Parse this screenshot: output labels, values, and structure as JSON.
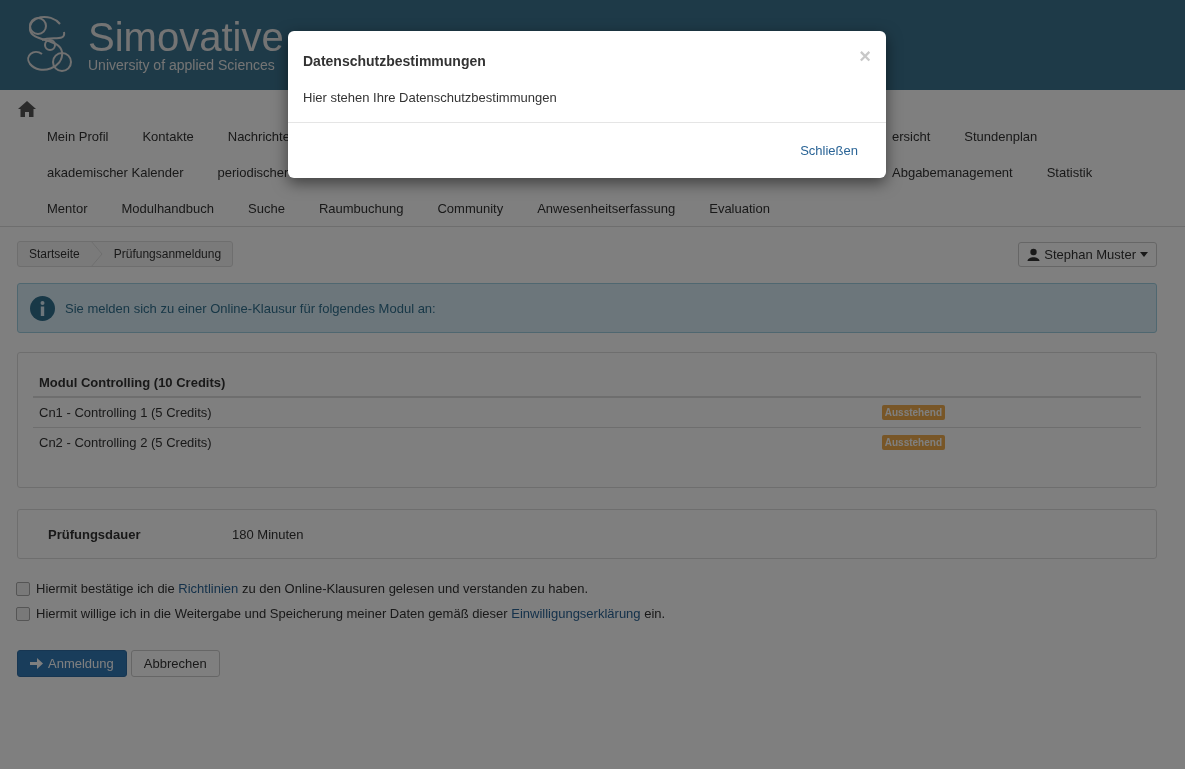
{
  "header": {
    "title": "Simovative",
    "subtitle": "University of applied Sciences"
  },
  "nav": {
    "rows": [
      {
        "left": [
          {
            "label": "Mein Profil"
          },
          {
            "label": "Kontakte"
          },
          {
            "label": "Nachrichte"
          }
        ],
        "right": [
          {
            "label": "ersicht"
          },
          {
            "label": "Stundenplan"
          }
        ]
      },
      {
        "left": [
          {
            "label": "akademischer Kalender"
          },
          {
            "label": "periodischer"
          }
        ],
        "right": [
          {
            "label": "Abgabemanagement"
          },
          {
            "label": "Statistik"
          }
        ]
      },
      {
        "left": [
          {
            "label": "Mentor"
          },
          {
            "label": "Modulhandbuch"
          },
          {
            "label": "Suche"
          },
          {
            "label": "Raumbuchung"
          },
          {
            "label": "Community"
          },
          {
            "label": "Anwesenheitserfassung"
          },
          {
            "label": "Evaluation"
          }
        ],
        "right": []
      }
    ]
  },
  "breadcrumb": [
    "Startseite",
    "Prüfungsanmeldung"
  ],
  "user_menu": "Stephan Muster",
  "alert": "Sie melden sich zu einer Online-Klausur für folgendes Modul an:",
  "module": {
    "title": "Modul Controlling (10 Credits)",
    "rows": [
      {
        "name": "Cn1 - Controlling 1 (5 Credits)",
        "status": "Ausstehend"
      },
      {
        "name": "Cn2 - Controlling 2 (5 Credits)",
        "status": "Ausstehend"
      }
    ]
  },
  "duration": {
    "label": "Prüfungsdauer",
    "value": "180 Minuten"
  },
  "consents": [
    {
      "before": "Hiermit bestätige ich die ",
      "link": "Richtlinien",
      "after": " zu den Online-Klausuren gelesen und verstanden zu haben.",
      "checked": false
    },
    {
      "before": "Hiermit willige ich in die Weitergabe und Speicherung meiner Daten gemäß dieser ",
      "link": "Einwilligungserklärung",
      "after": " ein.",
      "checked": false
    }
  ],
  "buttons": {
    "submit": "Anmeldung",
    "cancel": "Abbrechen"
  },
  "dialog": {
    "title": "Datenschutzbestimmungen",
    "close": "×",
    "body": "Hier stehen Ihre Datenschutzbestimmungen",
    "footer_link": "Schließen"
  }
}
